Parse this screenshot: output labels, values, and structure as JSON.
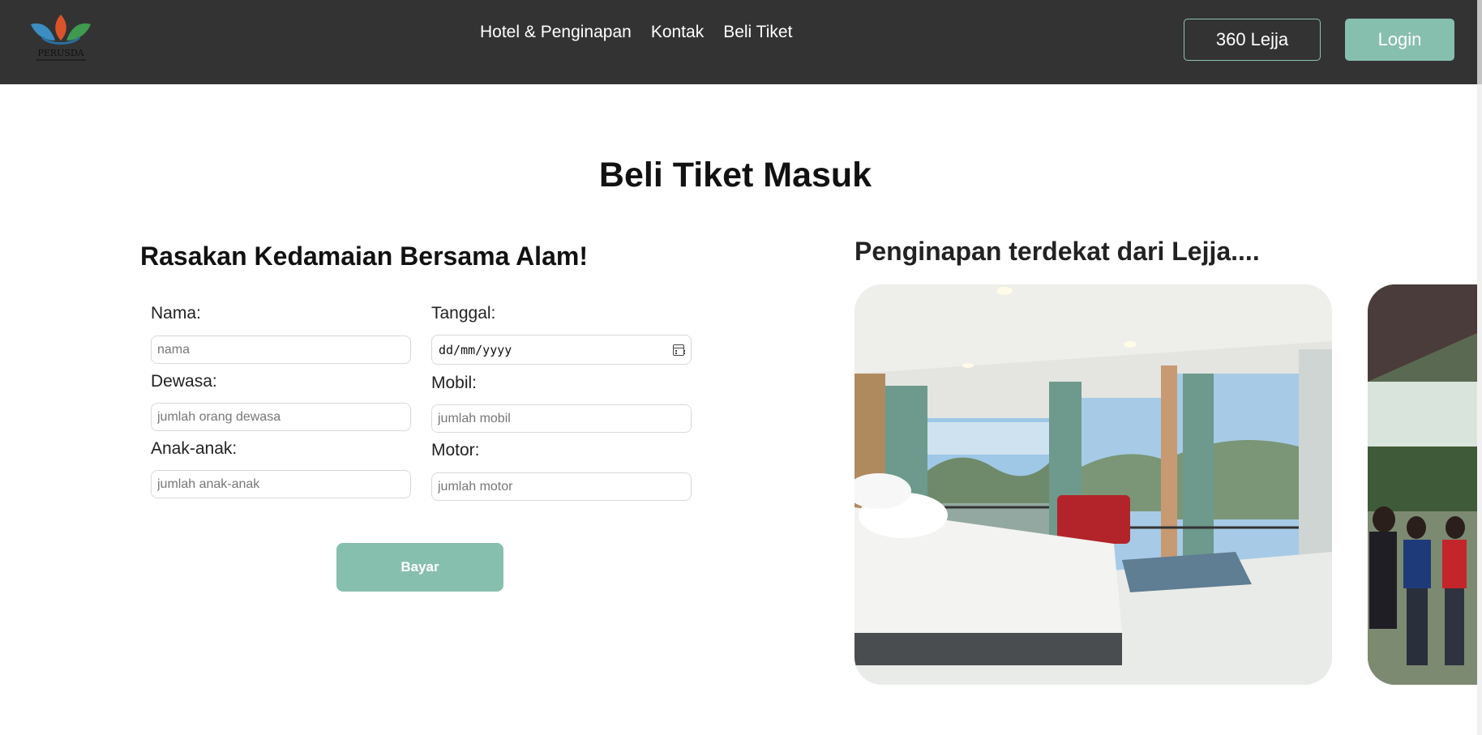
{
  "nav": {
    "logo_text": "PERUSDA",
    "links": [
      "Hotel & Penginapan",
      "Kontak",
      "Beli Tiket"
    ],
    "btn_360": "360 Lejja",
    "btn_login": "Login"
  },
  "page": {
    "title": "Beli Tiket Masuk"
  },
  "form": {
    "heading": "Rasakan Kedamaian Bersama Alam!",
    "nama": {
      "label": "Nama:",
      "placeholder": "nama"
    },
    "tanggal": {
      "label": "Tanggal:",
      "value": "dd/mm/yyyy",
      "icon": "calendar-icon"
    },
    "dewasa": {
      "label": "Dewasa:",
      "placeholder": "jumlah orang dewasa"
    },
    "mobil": {
      "label": "Mobil:",
      "placeholder": "jumlah mobil"
    },
    "anak": {
      "label": "Anak-anak:",
      "placeholder": "jumlah anak-anak"
    },
    "motor": {
      "label": "Motor:",
      "placeholder": "jumlah motor"
    },
    "submit": "Bayar"
  },
  "side": {
    "heading": "Penginapan terdekat dari Lejja...."
  },
  "colors": {
    "navbar": "#333333",
    "accent": "#87bfae"
  }
}
